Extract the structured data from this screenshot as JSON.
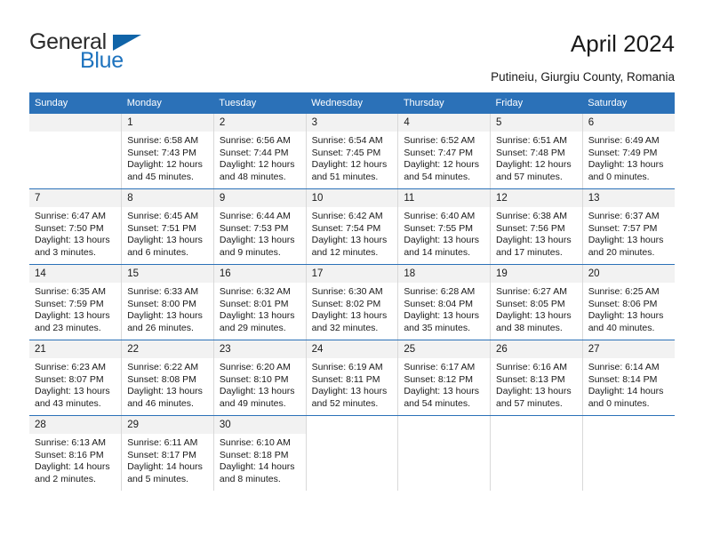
{
  "brand": {
    "name_part1": "General",
    "name_part2": "Blue",
    "flag_icon": "triangle-flag-icon",
    "accent_color": "#1e73be"
  },
  "header": {
    "title": "April 2024",
    "subtitle": "Putineiu, Giurgiu County, Romania"
  },
  "calendar": {
    "header_background": "#2b71b8",
    "daynum_background": "#f2f2f2",
    "weekday_headers": [
      "Sunday",
      "Monday",
      "Tuesday",
      "Wednesday",
      "Thursday",
      "Friday",
      "Saturday"
    ],
    "weeks": [
      [
        {
          "day": "",
          "sunrise": "",
          "sunset": "",
          "daylight_line1": "",
          "daylight_line2": "",
          "empty": true
        },
        {
          "day": "1",
          "sunrise": "Sunrise: 6:58 AM",
          "sunset": "Sunset: 7:43 PM",
          "daylight_line1": "Daylight: 12 hours",
          "daylight_line2": "and 45 minutes."
        },
        {
          "day": "2",
          "sunrise": "Sunrise: 6:56 AM",
          "sunset": "Sunset: 7:44 PM",
          "daylight_line1": "Daylight: 12 hours",
          "daylight_line2": "and 48 minutes."
        },
        {
          "day": "3",
          "sunrise": "Sunrise: 6:54 AM",
          "sunset": "Sunset: 7:45 PM",
          "daylight_line1": "Daylight: 12 hours",
          "daylight_line2": "and 51 minutes."
        },
        {
          "day": "4",
          "sunrise": "Sunrise: 6:52 AM",
          "sunset": "Sunset: 7:47 PM",
          "daylight_line1": "Daylight: 12 hours",
          "daylight_line2": "and 54 minutes."
        },
        {
          "day": "5",
          "sunrise": "Sunrise: 6:51 AM",
          "sunset": "Sunset: 7:48 PM",
          "daylight_line1": "Daylight: 12 hours",
          "daylight_line2": "and 57 minutes."
        },
        {
          "day": "6",
          "sunrise": "Sunrise: 6:49 AM",
          "sunset": "Sunset: 7:49 PM",
          "daylight_line1": "Daylight: 13 hours",
          "daylight_line2": "and 0 minutes."
        }
      ],
      [
        {
          "day": "7",
          "sunrise": "Sunrise: 6:47 AM",
          "sunset": "Sunset: 7:50 PM",
          "daylight_line1": "Daylight: 13 hours",
          "daylight_line2": "and 3 minutes."
        },
        {
          "day": "8",
          "sunrise": "Sunrise: 6:45 AM",
          "sunset": "Sunset: 7:51 PM",
          "daylight_line1": "Daylight: 13 hours",
          "daylight_line2": "and 6 minutes."
        },
        {
          "day": "9",
          "sunrise": "Sunrise: 6:44 AM",
          "sunset": "Sunset: 7:53 PM",
          "daylight_line1": "Daylight: 13 hours",
          "daylight_line2": "and 9 minutes."
        },
        {
          "day": "10",
          "sunrise": "Sunrise: 6:42 AM",
          "sunset": "Sunset: 7:54 PM",
          "daylight_line1": "Daylight: 13 hours",
          "daylight_line2": "and 12 minutes."
        },
        {
          "day": "11",
          "sunrise": "Sunrise: 6:40 AM",
          "sunset": "Sunset: 7:55 PM",
          "daylight_line1": "Daylight: 13 hours",
          "daylight_line2": "and 14 minutes."
        },
        {
          "day": "12",
          "sunrise": "Sunrise: 6:38 AM",
          "sunset": "Sunset: 7:56 PM",
          "daylight_line1": "Daylight: 13 hours",
          "daylight_line2": "and 17 minutes."
        },
        {
          "day": "13",
          "sunrise": "Sunrise: 6:37 AM",
          "sunset": "Sunset: 7:57 PM",
          "daylight_line1": "Daylight: 13 hours",
          "daylight_line2": "and 20 minutes."
        }
      ],
      [
        {
          "day": "14",
          "sunrise": "Sunrise: 6:35 AM",
          "sunset": "Sunset: 7:59 PM",
          "daylight_line1": "Daylight: 13 hours",
          "daylight_line2": "and 23 minutes."
        },
        {
          "day": "15",
          "sunrise": "Sunrise: 6:33 AM",
          "sunset": "Sunset: 8:00 PM",
          "daylight_line1": "Daylight: 13 hours",
          "daylight_line2": "and 26 minutes."
        },
        {
          "day": "16",
          "sunrise": "Sunrise: 6:32 AM",
          "sunset": "Sunset: 8:01 PM",
          "daylight_line1": "Daylight: 13 hours",
          "daylight_line2": "and 29 minutes."
        },
        {
          "day": "17",
          "sunrise": "Sunrise: 6:30 AM",
          "sunset": "Sunset: 8:02 PM",
          "daylight_line1": "Daylight: 13 hours",
          "daylight_line2": "and 32 minutes."
        },
        {
          "day": "18",
          "sunrise": "Sunrise: 6:28 AM",
          "sunset": "Sunset: 8:04 PM",
          "daylight_line1": "Daylight: 13 hours",
          "daylight_line2": "and 35 minutes."
        },
        {
          "day": "19",
          "sunrise": "Sunrise: 6:27 AM",
          "sunset": "Sunset: 8:05 PM",
          "daylight_line1": "Daylight: 13 hours",
          "daylight_line2": "and 38 minutes."
        },
        {
          "day": "20",
          "sunrise": "Sunrise: 6:25 AM",
          "sunset": "Sunset: 8:06 PM",
          "daylight_line1": "Daylight: 13 hours",
          "daylight_line2": "and 40 minutes."
        }
      ],
      [
        {
          "day": "21",
          "sunrise": "Sunrise: 6:23 AM",
          "sunset": "Sunset: 8:07 PM",
          "daylight_line1": "Daylight: 13 hours",
          "daylight_line2": "and 43 minutes."
        },
        {
          "day": "22",
          "sunrise": "Sunrise: 6:22 AM",
          "sunset": "Sunset: 8:08 PM",
          "daylight_line1": "Daylight: 13 hours",
          "daylight_line2": "and 46 minutes."
        },
        {
          "day": "23",
          "sunrise": "Sunrise: 6:20 AM",
          "sunset": "Sunset: 8:10 PM",
          "daylight_line1": "Daylight: 13 hours",
          "daylight_line2": "and 49 minutes."
        },
        {
          "day": "24",
          "sunrise": "Sunrise: 6:19 AM",
          "sunset": "Sunset: 8:11 PM",
          "daylight_line1": "Daylight: 13 hours",
          "daylight_line2": "and 52 minutes."
        },
        {
          "day": "25",
          "sunrise": "Sunrise: 6:17 AM",
          "sunset": "Sunset: 8:12 PM",
          "daylight_line1": "Daylight: 13 hours",
          "daylight_line2": "and 54 minutes."
        },
        {
          "day": "26",
          "sunrise": "Sunrise: 6:16 AM",
          "sunset": "Sunset: 8:13 PM",
          "daylight_line1": "Daylight: 13 hours",
          "daylight_line2": "and 57 minutes."
        },
        {
          "day": "27",
          "sunrise": "Sunrise: 6:14 AM",
          "sunset": "Sunset: 8:14 PM",
          "daylight_line1": "Daylight: 14 hours",
          "daylight_line2": "and 0 minutes."
        }
      ],
      [
        {
          "day": "28",
          "sunrise": "Sunrise: 6:13 AM",
          "sunset": "Sunset: 8:16 PM",
          "daylight_line1": "Daylight: 14 hours",
          "daylight_line2": "and 2 minutes."
        },
        {
          "day": "29",
          "sunrise": "Sunrise: 6:11 AM",
          "sunset": "Sunset: 8:17 PM",
          "daylight_line1": "Daylight: 14 hours",
          "daylight_line2": "and 5 minutes."
        },
        {
          "day": "30",
          "sunrise": "Sunrise: 6:10 AM",
          "sunset": "Sunset: 8:18 PM",
          "daylight_line1": "Daylight: 14 hours",
          "daylight_line2": "and 8 minutes."
        },
        {
          "day": "",
          "sunrise": "",
          "sunset": "",
          "daylight_line1": "",
          "daylight_line2": "",
          "blank": true
        },
        {
          "day": "",
          "sunrise": "",
          "sunset": "",
          "daylight_line1": "",
          "daylight_line2": "",
          "blank": true
        },
        {
          "day": "",
          "sunrise": "",
          "sunset": "",
          "daylight_line1": "",
          "daylight_line2": "",
          "blank": true
        },
        {
          "day": "",
          "sunrise": "",
          "sunset": "",
          "daylight_line1": "",
          "daylight_line2": "",
          "blank": true
        }
      ]
    ]
  }
}
